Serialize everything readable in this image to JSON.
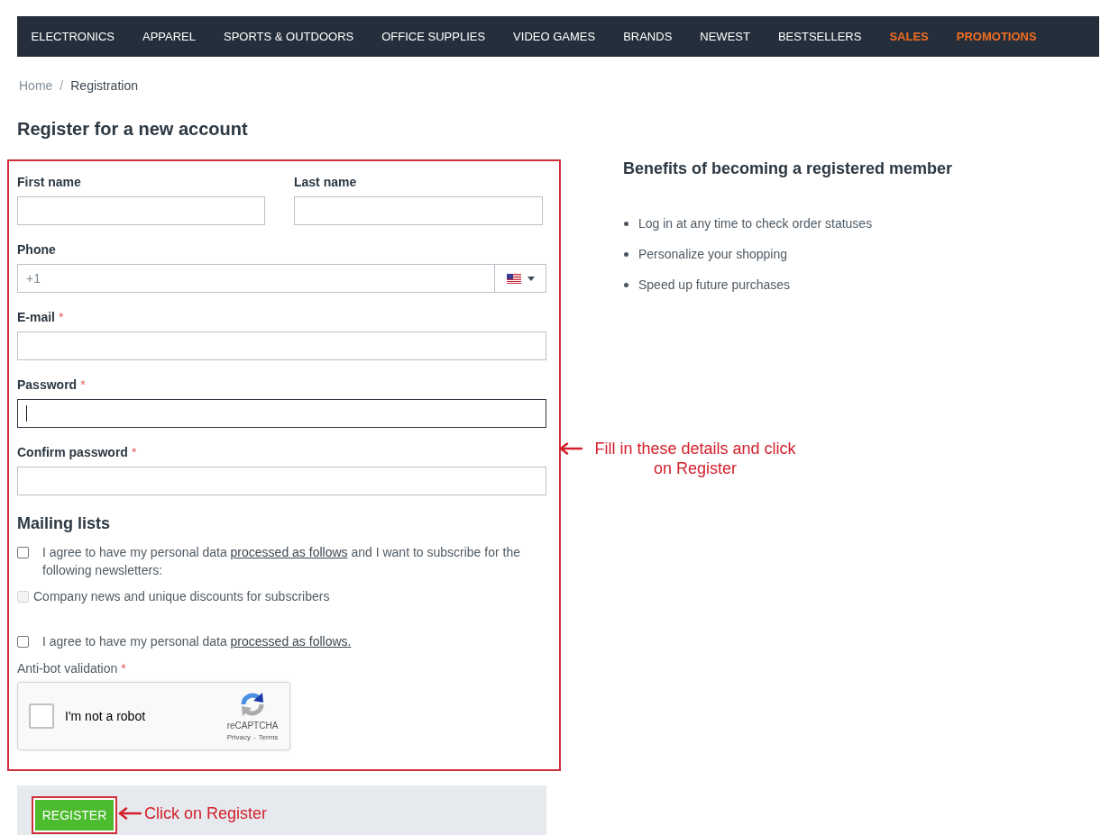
{
  "nav": {
    "items": [
      {
        "label": "ELECTRONICS",
        "kind": "regular"
      },
      {
        "label": "APPAREL",
        "kind": "regular"
      },
      {
        "label": "SPORTS & OUTDOORS",
        "kind": "regular"
      },
      {
        "label": "OFFICE SUPPLIES",
        "kind": "regular"
      },
      {
        "label": "VIDEO GAMES",
        "kind": "regular"
      },
      {
        "label": "BRANDS",
        "kind": "regular"
      },
      {
        "label": "NEWEST",
        "kind": "regular"
      },
      {
        "label": "BESTSELLERS",
        "kind": "regular"
      },
      {
        "label": "SALES",
        "kind": "promo"
      },
      {
        "label": "PROMOTIONS",
        "kind": "promo"
      }
    ]
  },
  "breadcrumb": {
    "separator": "/",
    "items": [
      {
        "label": "Home",
        "kind": "link"
      },
      {
        "label": "Registration",
        "kind": "current"
      }
    ]
  },
  "page_title": "Register for a new account",
  "form": {
    "required_mark": "*",
    "name_fields": [
      {
        "label": "First name",
        "required": false,
        "focused": false
      },
      {
        "label": "Last name",
        "required": false,
        "focused": false
      }
    ],
    "phone": {
      "label": "Phone",
      "required": false,
      "placeholder": "+1",
      "focused": false
    },
    "fields": [
      {
        "label": "E-mail",
        "required": true,
        "focused": false
      },
      {
        "label": "Password",
        "required": true,
        "focused": true
      },
      {
        "label": "Confirm password",
        "required": true,
        "focused": false
      }
    ]
  },
  "mailing_lists": {
    "title": "Mailing lists",
    "options": [
      {
        "kind": "consent",
        "text_before": "I agree to have my personal data",
        "link": "processed as follows",
        "text_after": "and I want to subscribe for the following newsletters:",
        "checked": false,
        "disabled": false
      },
      {
        "kind": "newsletter",
        "text": "Company news and unique discounts for subscribers",
        "checked": false,
        "disabled": true
      },
      {
        "kind": "consent",
        "text_before": "I agree to have my personal data",
        "link": "processed as follows.",
        "checked": false,
        "disabled": false
      }
    ]
  },
  "anti_bot": {
    "label": "Anti-bot validation",
    "required": true,
    "captcha": {
      "label": "I'm not a robot",
      "checked": false,
      "brand": "reCAPTCHA",
      "links": [
        "Privacy",
        "Terms"
      ],
      "separator": "-"
    }
  },
  "register_button": {
    "label": "REGISTER"
  },
  "benefits": {
    "title": "Benefits of becoming a registered member",
    "items": [
      "Log in at any time to check order statuses",
      "Personalize your shopping",
      "Speed up future purchases"
    ]
  },
  "annotations": {
    "form_callout": "Fill in these details and click on Register",
    "button_callout": "Click on Register"
  }
}
